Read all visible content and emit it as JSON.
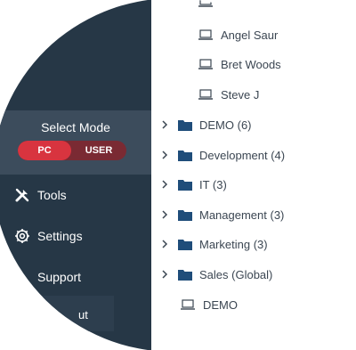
{
  "sidebar": {
    "mode_title": "Select Mode",
    "mode_options": {
      "pc": "PC",
      "user": "USER"
    },
    "items": [
      {
        "label": "Tools"
      },
      {
        "label": "Settings"
      },
      {
        "label": "Support"
      }
    ],
    "partial_item": "ut"
  },
  "tree": {
    "devices_top": [
      {
        "label": "Angel Saur"
      },
      {
        "label": "Bret Woods"
      },
      {
        "label": "Steve J"
      }
    ],
    "groups": [
      {
        "label": "DEMO (6)"
      },
      {
        "label": "Development (4)"
      },
      {
        "label": "IT (3)"
      },
      {
        "label": "Management (3)"
      },
      {
        "label": "Marketing (3)"
      },
      {
        "label": "Sales (Global)"
      }
    ],
    "devices_bottom": [
      {
        "label": "DEMO"
      }
    ]
  },
  "colors": {
    "sidebar_bg": "#263746",
    "mode_panel_bg": "#3c4c5c",
    "accent_red": "#d8343f",
    "folder_blue": "#1f4d7a",
    "tree_text": "#3b4652"
  }
}
